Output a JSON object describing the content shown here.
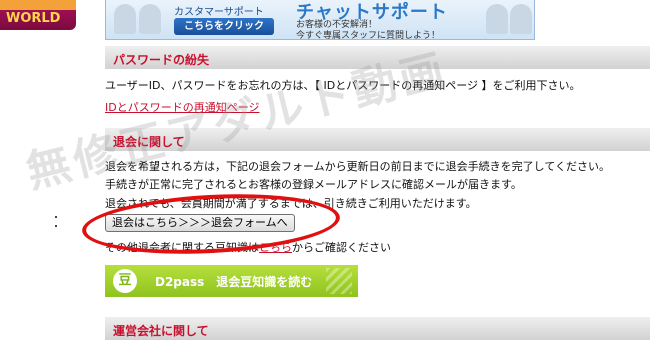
{
  "logo": {
    "world_text": "WORLD"
  },
  "banner": {
    "small_title": "カスタマーサポート",
    "big_title": "チャットサポート",
    "click_label": "こちらをクリック",
    "sub_line1": "お客様の不安解消！",
    "sub_line2": "今すぐ専属スタッフに質問しよう！"
  },
  "password_section": {
    "header": "パスワードの紛失",
    "body": "ユーザーID、パスワードをお忘れの方は、【 IDとパスワードの再通知ページ 】をご利用下さい。",
    "link": "IDとパスワードの再通知ページ"
  },
  "withdraw_section": {
    "header": "退会に関して",
    "line1": "退会を希望される方は，下記の退会フォームから更新日の前日までに退会手続きを完了してください。",
    "line2": "手続きが正常に完了されるとお客様の登録メールアドレスに確認メールが届きます。",
    "line3": "退会されても、会員期間が満了するまでは、引き続きご利用いただけます。",
    "button_label": "退会はこちら＞＞＞退会フォームへ",
    "info_prefix": "その他退会者に関する豆知識は",
    "info_link": "こちら",
    "info_suffix": "からご確認ください"
  },
  "green_banner": {
    "bean_char": "豆",
    "label": "D2pass　退会豆知識を読む"
  },
  "company_section": {
    "header": "運営会社に関して"
  },
  "watermark_text": "無修正アダルト動画"
}
